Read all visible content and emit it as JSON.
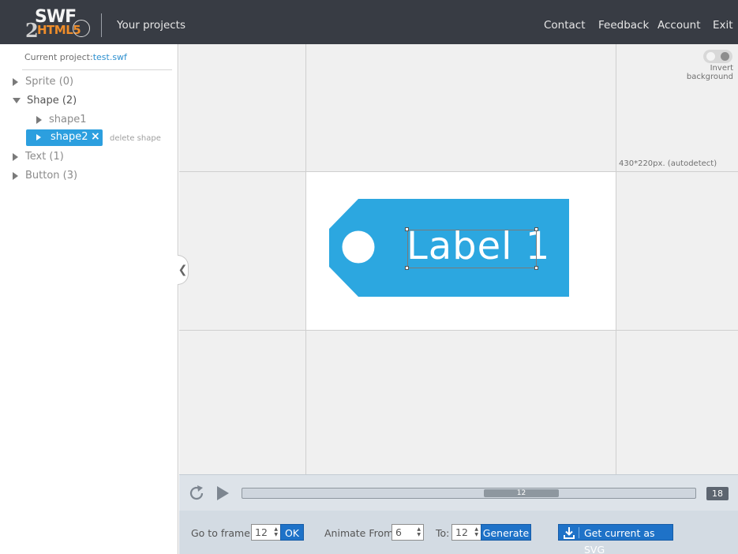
{
  "header": {
    "logo": {
      "swf": "SWF",
      "two": "2",
      "html5": "HTML5"
    },
    "your_projects": "Your projects",
    "nav": {
      "contact": "Contact",
      "feedback": "Feedback",
      "account": "Account",
      "exit": "Exit"
    }
  },
  "sidebar": {
    "current_project_label": "Current project:",
    "current_project_name": "test.swf",
    "tree": [
      {
        "label": "Sprite (0)",
        "expanded": false
      },
      {
        "label": "Shape (2)",
        "expanded": true
      },
      {
        "label": "shape1",
        "expanded": false
      },
      {
        "label": "shape2",
        "expanded": false,
        "selected": true
      },
      {
        "label": "Text (1)",
        "expanded": false
      },
      {
        "label": "Button (3)",
        "expanded": false
      }
    ],
    "close_glyph": "×",
    "delete_shape": "delete shape",
    "collapse_glyph": "❮"
  },
  "stage": {
    "size_label": "430*220px. (autodetect)",
    "invert_background": "Invert background",
    "tag_text": "Label 1",
    "tag_color": "#2ca7e0"
  },
  "timeline": {
    "current_frame": "12",
    "total_frames": "18",
    "position_fraction": 0.63
  },
  "controls": {
    "goto_label": "Go to frame:",
    "goto_value": "12",
    "ok": "OK",
    "animate_from_label": "Animate From:",
    "animate_from_value": "6",
    "to_label": "To:",
    "to_value": "12",
    "generate": "Generate",
    "get_svg": "Get current as SVG",
    "spin_arrows": "▲\n▼"
  },
  "colors": {
    "header_bg": "#383c44",
    "accent_blue": "#2c9fdf",
    "button_blue": "#1e72c8",
    "logo_orange": "#ef8d2a"
  }
}
